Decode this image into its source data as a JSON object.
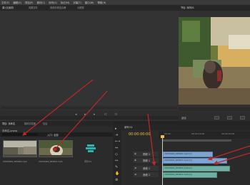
{
  "menu": [
    "文件(F)",
    "编辑(E)",
    "项目(P)",
    "素材(C)",
    "序列(S)",
    "标记(M)",
    "字幕(T)",
    "窗口(W)",
    "帮助(H)"
  ],
  "source": {
    "tabs": [
      "源:(无素材)",
      "效果控件",
      "音频剪辑混合器",
      "元数据"
    ]
  },
  "program": {
    "tab": "节目: 序列01",
    "fit_label": "适合"
  },
  "project": {
    "tabs": [
      "项目: 未命名",
      "媒体浏览器",
      "信息"
    ],
    "path": "未命名.prproj",
    "search_placeholder": "",
    "entry_label": "入口: 全部",
    "items": [
      {
        "caption": "20150926_095810.mp4",
        "thumb": "street"
      },
      {
        "caption": "20150926_095812.mp4",
        "thumb": "dog"
      },
      {
        "caption": "序列 01",
        "thumb": "sequence"
      }
    ]
  },
  "timeline": {
    "tab": "序列 01",
    "timecode": "00:00:00:00",
    "ruler_labels": [
      "00:00",
      "00:00:15:00",
      "00:00:30:00"
    ],
    "tracks": [
      "视频 1",
      "视频 2",
      "音频 1",
      "音频 2"
    ],
    "clips": [
      {
        "track": "V2",
        "label": "20150926_095810.mp4 [V]"
      },
      {
        "track": "V1",
        "label": "20150926_095812.mp4 [V]"
      },
      {
        "track": "A1",
        "label": "20150926_095810.mp4 [A]"
      },
      {
        "track": "A2",
        "label": "20150926_095812.mp4 [A]"
      }
    ]
  },
  "colors": {
    "timecode": "#f0c040",
    "video_clip": "#7fa4d0",
    "audio_clip": "#6fb0a2",
    "annotation": "#c0282a"
  }
}
